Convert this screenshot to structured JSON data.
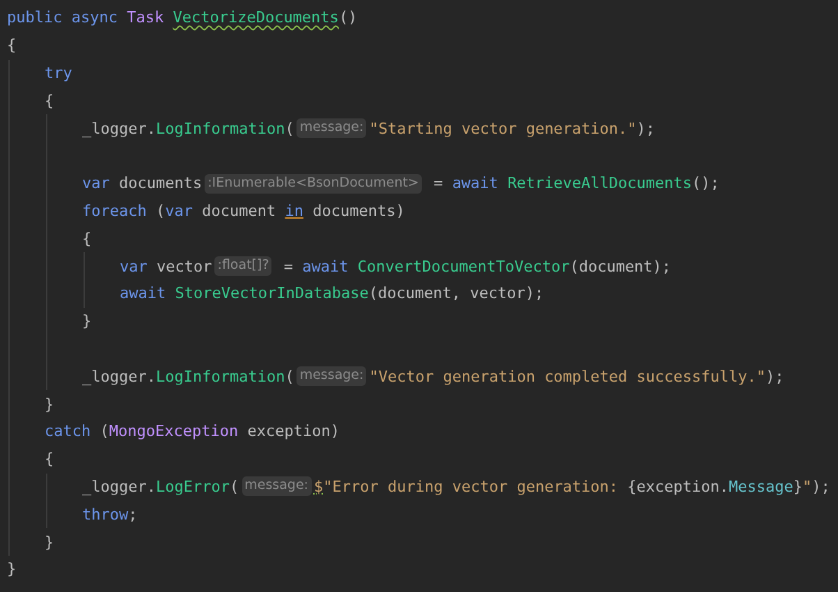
{
  "editor": {
    "lines": [
      {
        "kind": "code",
        "tokens": [
          {
            "kind": "keyword",
            "text": "public async "
          },
          {
            "kind": "type",
            "text": "Task "
          },
          {
            "kind": "warning",
            "text": "VectorizeDocuments"
          },
          {
            "kind": "plain",
            "text": "()"
          }
        ]
      },
      {
        "kind": "code",
        "tokens": [
          {
            "kind": "plain",
            "text": "{"
          }
        ],
        "children": [
          {
            "kind": "code",
            "tokens": [
              {
                "kind": "keyword",
                "text": "try"
              }
            ]
          },
          {
            "kind": "code",
            "tokens": [
              {
                "kind": "plain",
                "text": "{"
              }
            ],
            "children": [
              {
                "kind": "code",
                "tokens": [
                  {
                    "kind": "plain",
                    "text": "_logger."
                  },
                  {
                    "kind": "method",
                    "text": "LogInformation"
                  },
                  {
                    "kind": "plain",
                    "text": "("
                  },
                  {
                    "kind": "hint",
                    "text": "message:"
                  },
                  {
                    "kind": "string",
                    "text": "\"Starting vector generation.\""
                  },
                  {
                    "kind": "plain",
                    "text": ");"
                  }
                ]
              },
              {
                "kind": "blank"
              },
              {
                "kind": "code",
                "tokens": [
                  {
                    "kind": "keyword",
                    "text": "var "
                  },
                  {
                    "kind": "plain",
                    "text": "documents"
                  },
                  {
                    "kind": "hint",
                    "text": ":IEnumerable<BsonDocument>"
                  },
                  {
                    "kind": "plain",
                    "text": " = "
                  },
                  {
                    "kind": "keyword",
                    "text": "await "
                  },
                  {
                    "kind": "method",
                    "text": "RetrieveAllDocuments"
                  },
                  {
                    "kind": "plain",
                    "text": "();"
                  }
                ]
              },
              {
                "kind": "code",
                "tokens": [
                  {
                    "kind": "keyword",
                    "text": "foreach "
                  },
                  {
                    "kind": "plain",
                    "text": "("
                  },
                  {
                    "kind": "keyword",
                    "text": "var "
                  },
                  {
                    "kind": "plain",
                    "text": "document "
                  },
                  {
                    "kind": "usage",
                    "text": "in"
                  },
                  {
                    "kind": "plain",
                    "text": " documents)"
                  }
                ]
              },
              {
                "kind": "code",
                "tokens": [
                  {
                    "kind": "plain",
                    "text": "{"
                  }
                ],
                "children": [
                  {
                    "kind": "code",
                    "tokens": [
                      {
                        "kind": "keyword",
                        "text": "var "
                      },
                      {
                        "kind": "plain",
                        "text": "vector"
                      },
                      {
                        "kind": "hint",
                        "text": ":float[]?"
                      },
                      {
                        "kind": "plain",
                        "text": " = "
                      },
                      {
                        "kind": "keyword",
                        "text": "await "
                      },
                      {
                        "kind": "method",
                        "text": "ConvertDocumentToVector"
                      },
                      {
                        "kind": "plain",
                        "text": "(document);"
                      }
                    ]
                  },
                  {
                    "kind": "code",
                    "tokens": [
                      {
                        "kind": "keyword",
                        "text": "await "
                      },
                      {
                        "kind": "method",
                        "text": "StoreVectorInDatabase"
                      },
                      {
                        "kind": "plain",
                        "text": "(document, vector);"
                      }
                    ]
                  }
                ]
              },
              {
                "kind": "code",
                "tokens": [
                  {
                    "kind": "plain",
                    "text": "}"
                  }
                ]
              },
              {
                "kind": "blank"
              },
              {
                "kind": "code",
                "tokens": [
                  {
                    "kind": "plain",
                    "text": "_logger."
                  },
                  {
                    "kind": "method",
                    "text": "LogInformation"
                  },
                  {
                    "kind": "plain",
                    "text": "("
                  },
                  {
                    "kind": "hint",
                    "text": "message:"
                  },
                  {
                    "kind": "string",
                    "text": "\"Vector generation completed successfully.\""
                  },
                  {
                    "kind": "plain",
                    "text": ");"
                  }
                ]
              }
            ]
          },
          {
            "kind": "code",
            "tokens": [
              {
                "kind": "plain",
                "text": "}"
              }
            ]
          },
          {
            "kind": "code",
            "tokens": [
              {
                "kind": "keyword",
                "text": "catch "
              },
              {
                "kind": "plain",
                "text": "("
              },
              {
                "kind": "type",
                "text": "MongoException"
              },
              {
                "kind": "plain",
                "text": " exception)"
              }
            ]
          },
          {
            "kind": "code",
            "tokens": [
              {
                "kind": "plain",
                "text": "{"
              }
            ],
            "children": [
              {
                "kind": "code",
                "tokens": [
                  {
                    "kind": "plain",
                    "text": "_logger."
                  },
                  {
                    "kind": "method",
                    "text": "LogError"
                  },
                  {
                    "kind": "plain",
                    "text": "("
                  },
                  {
                    "kind": "hint",
                    "text": "message:"
                  },
                  {
                    "kind": "suggestion",
                    "text": "$"
                  },
                  {
                    "kind": "string",
                    "text": "\"Error during vector generation: "
                  },
                  {
                    "kind": "plain",
                    "text": "{exception."
                  },
                  {
                    "kind": "property",
                    "text": "Message"
                  },
                  {
                    "kind": "plain",
                    "text": "}"
                  },
                  {
                    "kind": "string",
                    "text": "\""
                  },
                  {
                    "kind": "plain",
                    "text": ");"
                  }
                ]
              },
              {
                "kind": "code",
                "tokens": [
                  {
                    "kind": "keyword",
                    "text": "throw"
                  },
                  {
                    "kind": "plain",
                    "text": ";"
                  }
                ]
              }
            ]
          },
          {
            "kind": "code",
            "tokens": [
              {
                "kind": "plain",
                "text": "}"
              }
            ]
          }
        ]
      },
      {
        "kind": "code",
        "tokens": [
          {
            "kind": "plain",
            "text": "}"
          }
        ]
      }
    ]
  }
}
